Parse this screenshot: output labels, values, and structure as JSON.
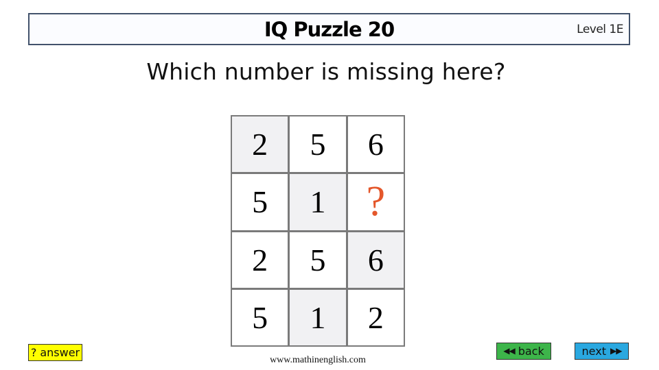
{
  "header": {
    "title": "IQ Puzzle 20",
    "level": "Level 1E"
  },
  "question": "Which number is missing here?",
  "puzzle": {
    "grid": [
      [
        {
          "value": "2",
          "shaded": true
        },
        {
          "value": "5",
          "shaded": false
        },
        {
          "value": "6",
          "shaded": false
        }
      ],
      [
        {
          "value": "5",
          "shaded": false
        },
        {
          "value": "1",
          "shaded": true
        },
        {
          "value": "?",
          "shaded": false,
          "missing": true
        }
      ],
      [
        {
          "value": "2",
          "shaded": false
        },
        {
          "value": "5",
          "shaded": false
        },
        {
          "value": "6",
          "shaded": true
        }
      ],
      [
        {
          "value": "5",
          "shaded": false
        },
        {
          "value": "1",
          "shaded": true
        },
        {
          "value": "2",
          "shaded": false
        }
      ]
    ],
    "missing_color": "#e4572b"
  },
  "watermark": "www.mathinenglish.com",
  "buttons": {
    "answer": {
      "icon": "question-mark-icon",
      "glyph": "?",
      "label": "answer",
      "color": "#ffff00"
    },
    "back": {
      "icon": "double-left-arrow-icon",
      "glyph": "◀◀",
      "label": "back",
      "color": "#3db54a"
    },
    "next": {
      "icon": "double-right-arrow-icon",
      "glyph": "▶▶",
      "label": "next",
      "color": "#2aa8e0"
    }
  }
}
